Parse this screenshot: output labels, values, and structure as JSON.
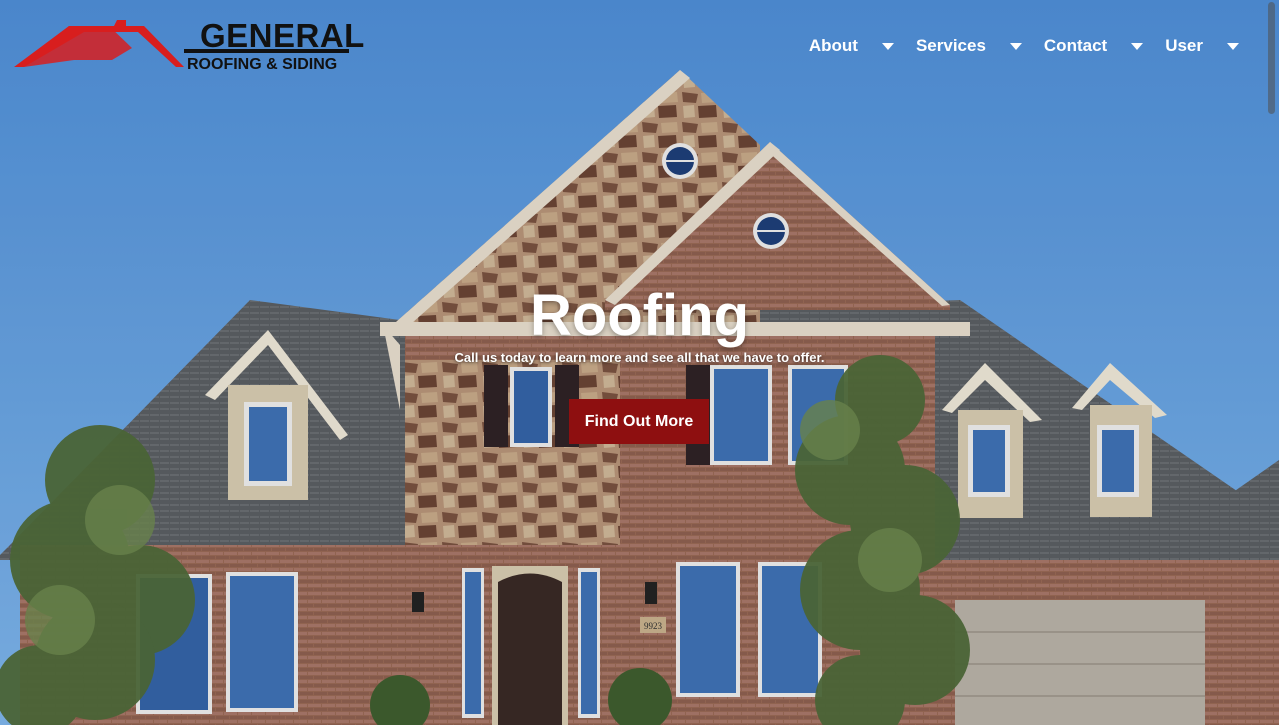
{
  "brand": {
    "name_line1": "GENERAL",
    "name_line2": "ROOFING & SIDING",
    "colors": {
      "roof": "#d81e1e",
      "text": "#111111"
    }
  },
  "nav": {
    "items": [
      {
        "label": "About",
        "icon": "caret-down-icon"
      },
      {
        "label": "Services",
        "icon": "caret-down-icon"
      },
      {
        "label": "Contact",
        "icon": "caret-down-icon"
      },
      {
        "label": "User",
        "icon": "caret-down-icon"
      }
    ]
  },
  "hero": {
    "title": "Roofing",
    "subtitle": "Call us today to learn more and see all that we have to offer.",
    "cta_label": "Find Out More",
    "cta_color": "#8e0f10",
    "house_number": "9923"
  }
}
